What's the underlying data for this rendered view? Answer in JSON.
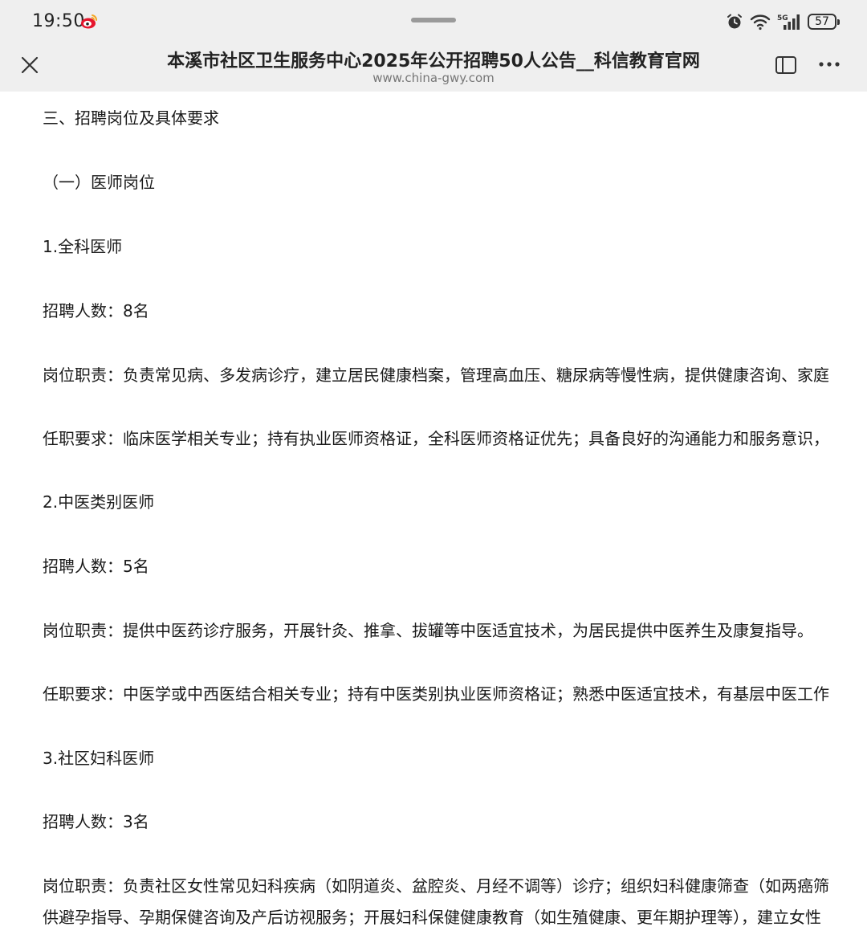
{
  "status_bar": {
    "time": "19:50",
    "battery": "57"
  },
  "browser": {
    "page_title": "本溪市社区卫生服务中心2025年公开招聘50人公告__科信教育官网",
    "url": "www.china-gwy.com"
  },
  "article": {
    "lines": [
      "三、招聘岗位及具体要求",
      "（一）医师岗位",
      "1.全科医师",
      "招聘人数：8名",
      "岗位职责：负责常见病、多发病诊疗，建立居民健康档案，管理高血压、糖尿病等慢性病，提供健康咨询、家庭",
      "任职要求：临床医学相关专业；持有执业医师资格证，全科医师资格证优先；具备良好的沟通能力和服务意识，",
      "2.中医类别医师",
      "招聘人数：5名",
      "岗位职责：提供中医药诊疗服务，开展针灸、推拿、拔罐等中医适宜技术，为居民提供中医养生及康复指导。",
      "任职要求：中医学或中西医结合相关专业；持有中医类别执业医师资格证；熟悉中医适宜技术，有基层中医工作",
      "3.社区妇科医师",
      "招聘人数：3名",
      "岗位职责：负责社区女性常见妇科疾病（如阴道炎、盆腔炎、月经不调等）诊疗；组织妇科健康筛查（如两癌筛",
      "供避孕指导、孕期保健咨询及产后访视服务；开展妇科保健健康教育（如生殖健康、更年期护理等），建立女性"
    ]
  },
  "colors": {
    "chrome_bg": "#efefef",
    "text": "#1a1a1a",
    "url_text": "#777777"
  },
  "icons": {
    "status_app": "weibo-icon",
    "alarm": "alarm-icon",
    "wifi": "wifi-icon",
    "signal": "5g-signal-icon",
    "close": "close-icon",
    "tabs": "tab-switcher-icon",
    "more": "more-icon"
  }
}
